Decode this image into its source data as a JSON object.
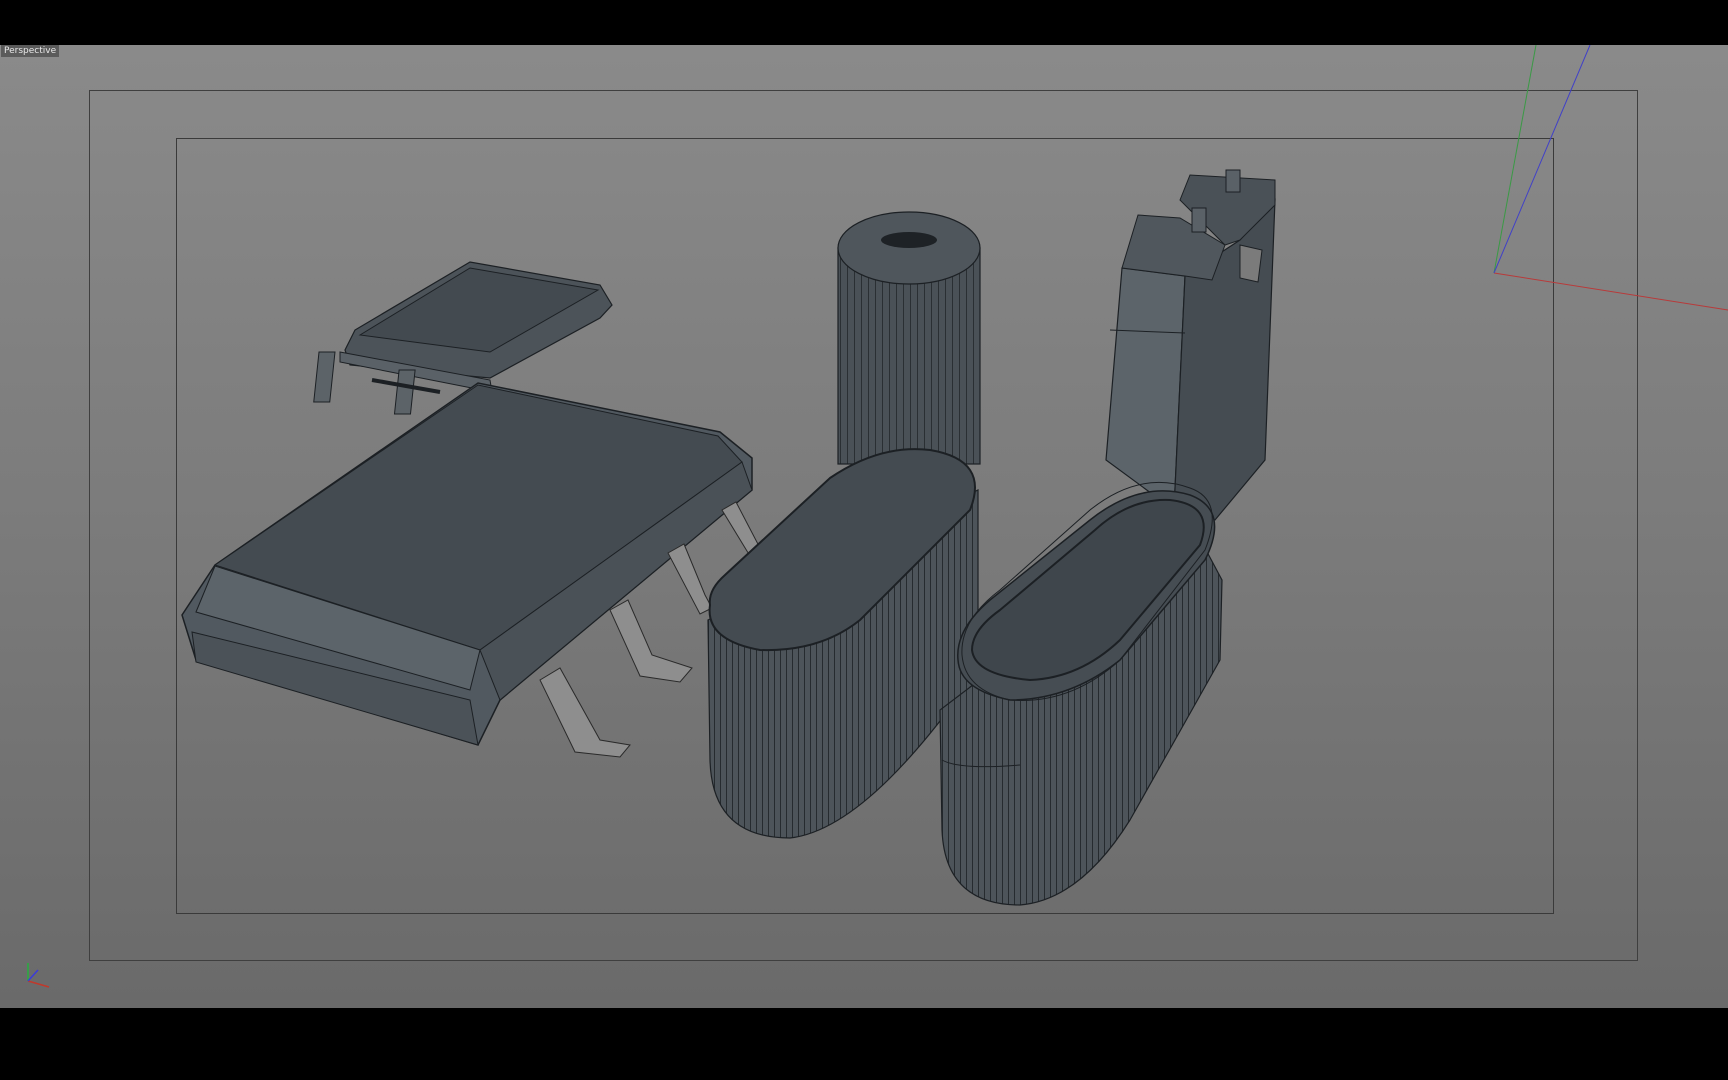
{
  "viewport": {
    "view_name": "Perspective"
  },
  "scene_objects": [
    "small-ic-package",
    "large-ic-package",
    "tall-cylinder",
    "oval-capacitor-left",
    "tall-box-component",
    "oval-capacitor-right"
  ],
  "axis_colors": {
    "x": "#c0392b",
    "y": "#27ae3f",
    "z": "#3b3bd9"
  },
  "colors": {
    "object_fill": "#4c5359",
    "object_top": "#424a50",
    "wire": "#1c2024",
    "pin": "#8e8e8e"
  }
}
